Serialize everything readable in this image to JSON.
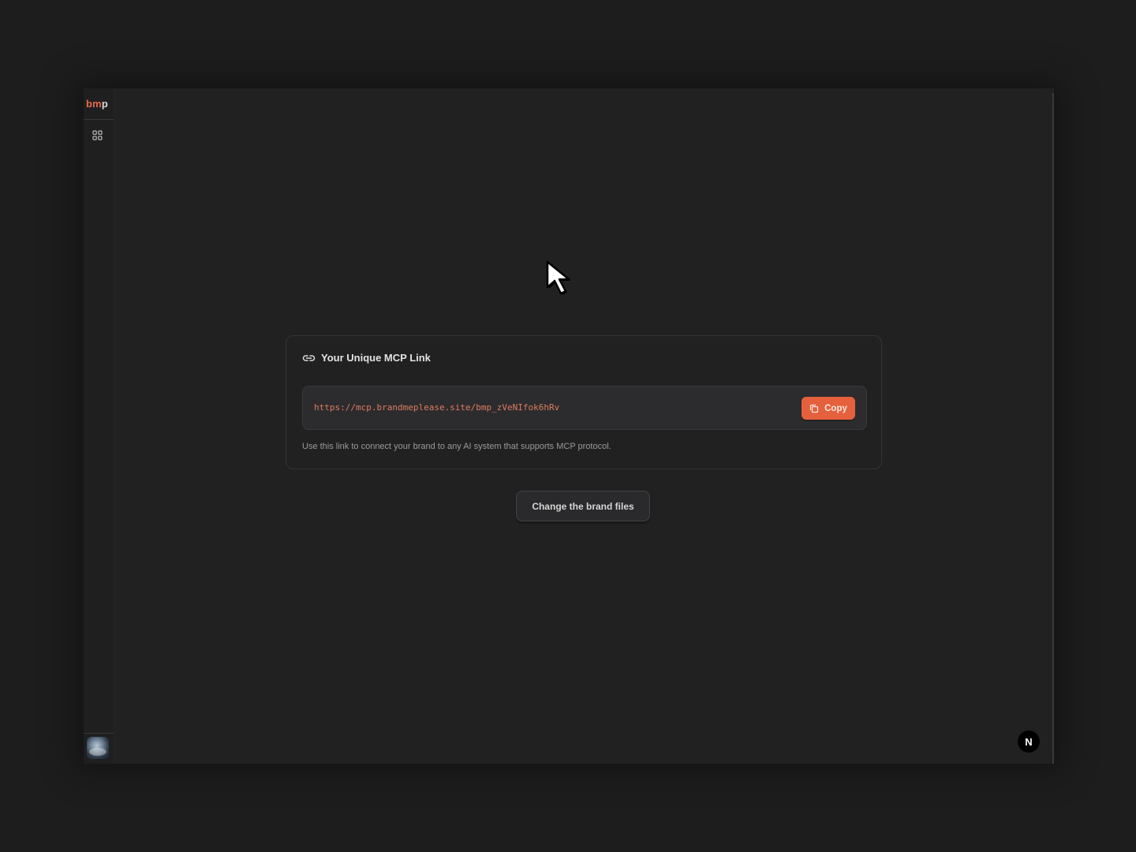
{
  "sidebar": {
    "logo_accent": "bm",
    "logo_rest": "p",
    "nav_icon": "grid-icon",
    "avatar_icon": "avatar-icon"
  },
  "mcp_card": {
    "title": "Your Unique MCP Link",
    "title_icon": "link-icon",
    "url": "https://mcp.brandmeplease.site/bmp_zVeNIfok6hRv",
    "copy_label": "Copy",
    "copy_icon": "copy-icon",
    "hint": "Use this link to connect your brand to any AI system that supports MCP protocol."
  },
  "actions": {
    "change_brand_files": "Change the brand files"
  },
  "dev_badge": {
    "label": "N"
  },
  "colors": {
    "accent": "#e5603c",
    "background": "#212122",
    "url_text": "#dd7c5f"
  }
}
